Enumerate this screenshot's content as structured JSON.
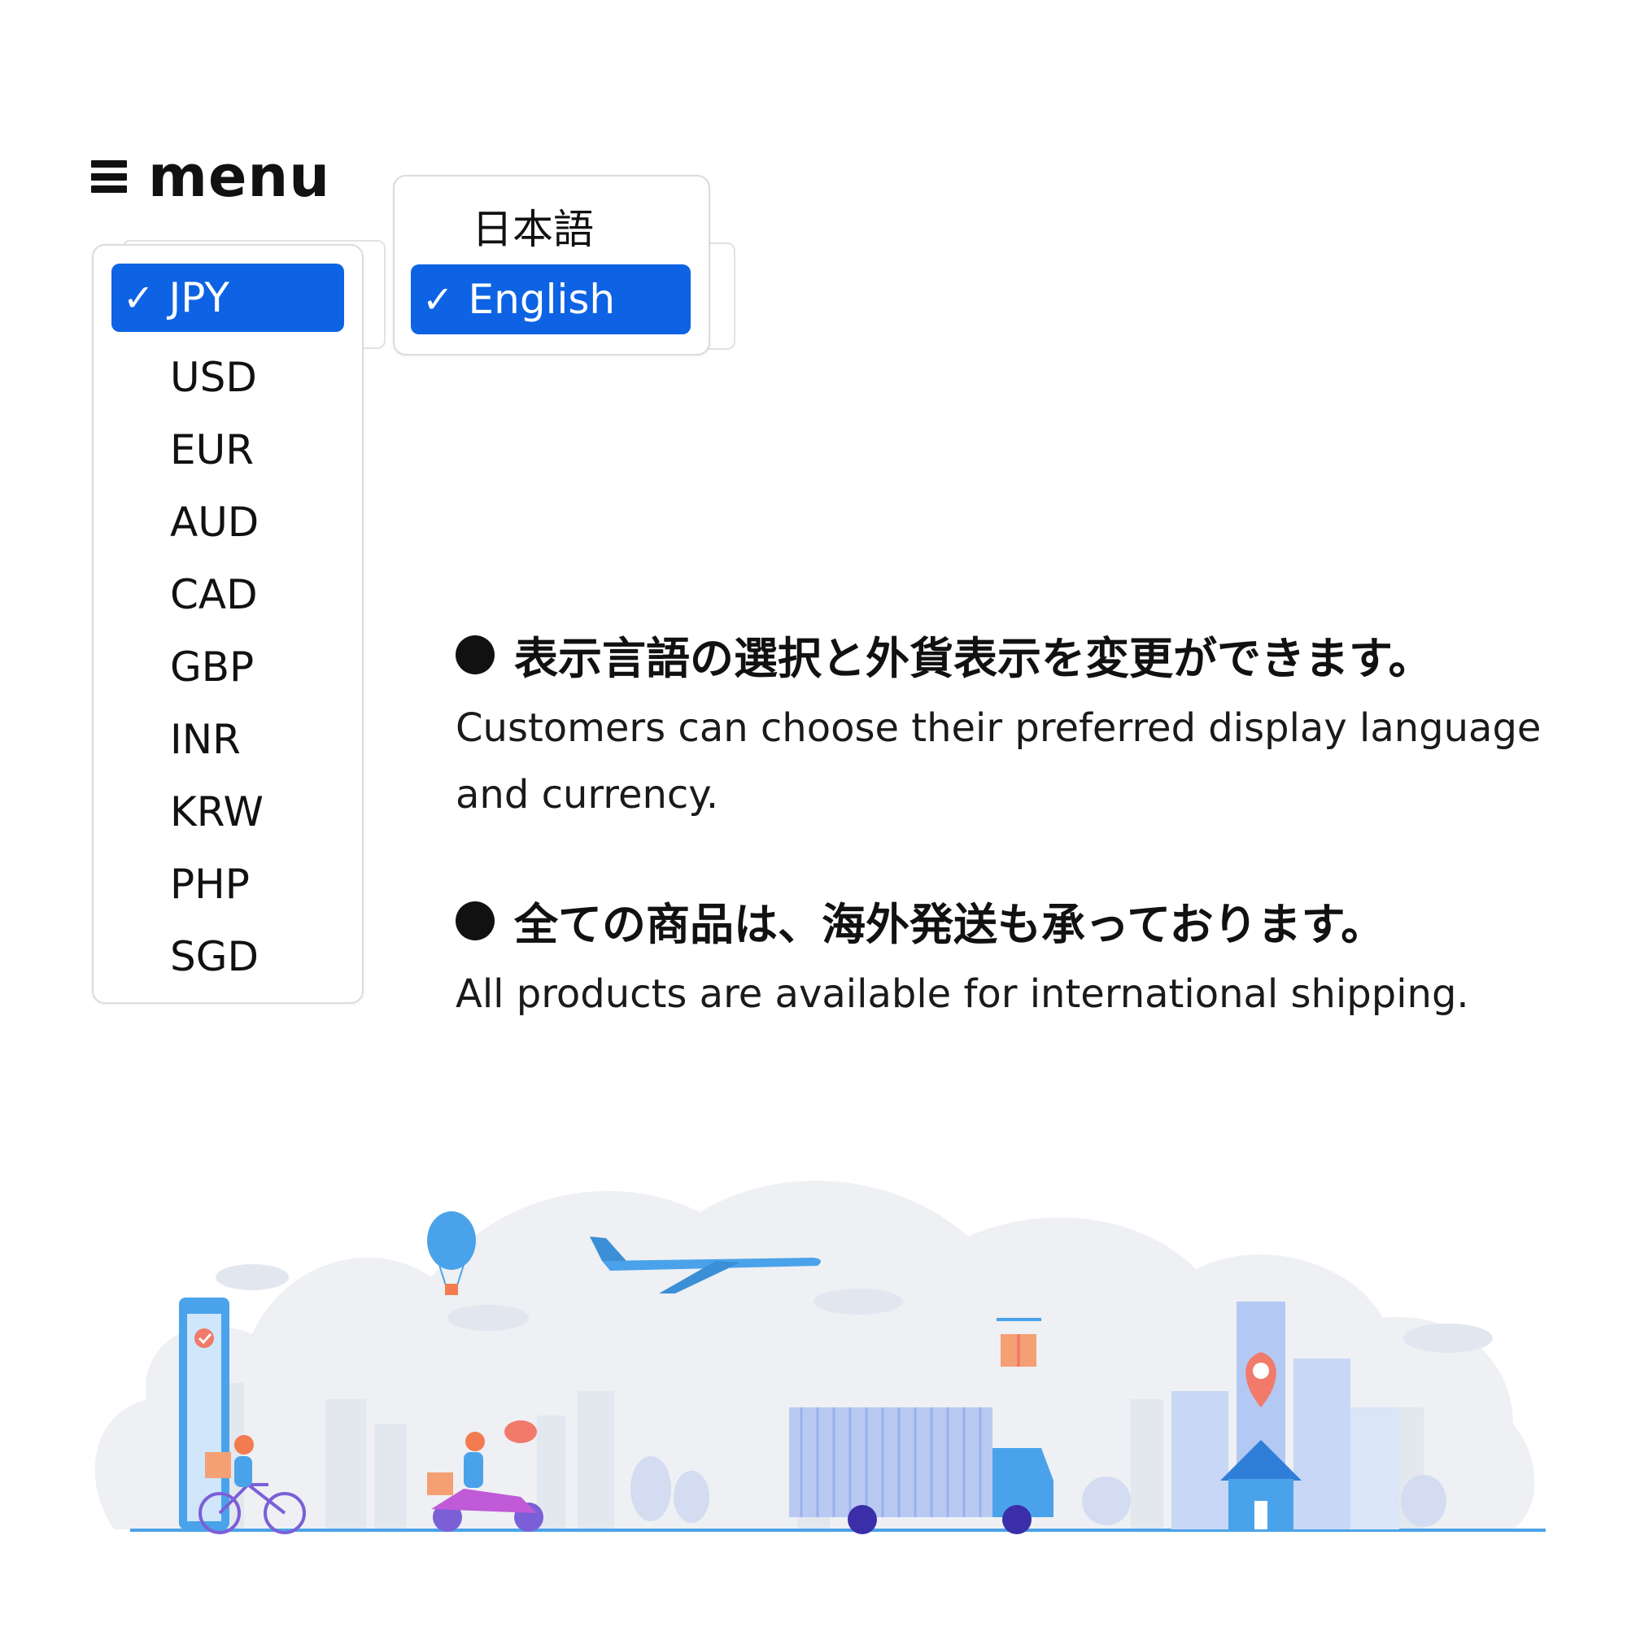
{
  "menu": {
    "icon": "hamburger-icon",
    "label": "menu"
  },
  "currency": {
    "selected": "JPY",
    "options": [
      "JPY",
      "USD",
      "EUR",
      "AUD",
      "CAD",
      "GBP",
      "INR",
      "KRW",
      "PHP",
      "SGD"
    ]
  },
  "language": {
    "selected": "English",
    "options": [
      "日本語",
      "English"
    ]
  },
  "check_mark": "✓",
  "features": [
    {
      "heading": "表示言語の選択と外貨表示を変更ができます。",
      "text": "Customers can choose their preferred display language and currency."
    },
    {
      "heading": "全ての商品は、海外発送も承っております。",
      "text": "All products are available for international shipping."
    }
  ],
  "colors": {
    "accent": "#0d63e3",
    "illustration_blue": "#4aa3ea",
    "illustration_bg": "#eef0f4"
  }
}
